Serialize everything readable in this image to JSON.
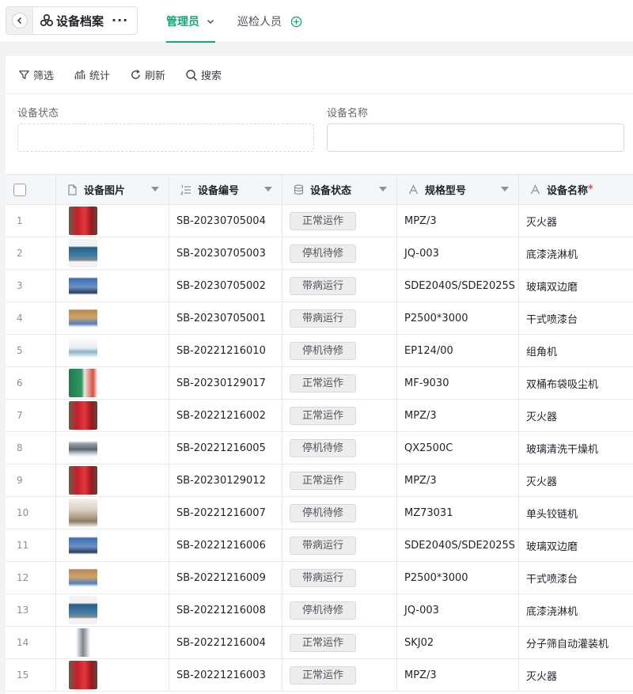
{
  "header": {
    "app_title": "设备档案",
    "tabs": [
      {
        "label": "管理员",
        "active": true
      },
      {
        "label": "巡检人员",
        "active": false
      }
    ],
    "accent_color": "#15a675"
  },
  "toolbar": {
    "filter": "筛选",
    "stats": "统计",
    "refresh": "刷新",
    "search": "搜索"
  },
  "filters": {
    "status_label": "设备状态",
    "name_label": "设备名称"
  },
  "table": {
    "columns": [
      "设备图片",
      "设备编号",
      "设备状态",
      "规格型号",
      "设备名称"
    ],
    "required_mark": "*",
    "rows": [
      {
        "no": "1",
        "image": "fire-extinguisher",
        "code": "SB-20230705004",
        "status": "正常运作",
        "model": "MPZ/3",
        "name": "灭火器"
      },
      {
        "no": "2",
        "image": "paint-line",
        "code": "SB-20230705003",
        "status": "停机待修",
        "model": "JQ-003",
        "name": "底漆浇淋机"
      },
      {
        "no": "3",
        "image": "edge-grinder",
        "code": "SB-20230705002",
        "status": "带病运行",
        "model": "SDE2040S/SDE2025S",
        "name": "玻璃双边磨"
      },
      {
        "no": "4",
        "image": "spray-booth",
        "code": "SB-20230705001",
        "status": "带病运行",
        "model": "P2500*3000",
        "name": "干式喷漆台"
      },
      {
        "no": "5",
        "image": "corner-machine",
        "code": "SB-20221216010",
        "status": "停机待修",
        "model": "EP124/00",
        "name": "组角机"
      },
      {
        "no": "6",
        "image": "dust-collector",
        "code": "SB-20230129017",
        "status": "正常运作",
        "model": "MF-9030",
        "name": "双桶布袋吸尘机"
      },
      {
        "no": "7",
        "image": "fire-extinguisher",
        "code": "SB-20221216002",
        "status": "正常运作",
        "model": "MPZ/3",
        "name": "灭火器"
      },
      {
        "no": "8",
        "image": "glass-washer",
        "code": "SB-20221216005",
        "status": "停机待修",
        "model": "QX2500C",
        "name": "玻璃清洗干燥机"
      },
      {
        "no": "9",
        "image": "fire-extinguisher",
        "code": "SB-20230129012",
        "status": "正常运作",
        "model": "MPZ/3",
        "name": "灭火器"
      },
      {
        "no": "10",
        "image": "hinge-drill",
        "code": "SB-20221216007",
        "status": "停机待修",
        "model": "MZ73031",
        "name": "单头铰链机"
      },
      {
        "no": "11",
        "image": "edge-grinder",
        "code": "SB-20221216006",
        "status": "带病运行",
        "model": "SDE2040S/SDE2025S",
        "name": "玻璃双边磨"
      },
      {
        "no": "12",
        "image": "spray-booth",
        "code": "SB-20221216009",
        "status": "带病运行",
        "model": "P2500*3000",
        "name": "干式喷漆台"
      },
      {
        "no": "13",
        "image": "paint-line",
        "code": "SB-20221216008",
        "status": "停机待修",
        "model": "JQ-003",
        "name": "底漆浇淋机"
      },
      {
        "no": "14",
        "image": "filling-machine",
        "code": "SB-20221216004",
        "status": "正常运作",
        "model": "SKJ02",
        "name": "分子筛自动灌装机"
      },
      {
        "no": "15",
        "image": "fire-extinguisher",
        "code": "SB-20221216003",
        "status": "正常运作",
        "model": "MPZ/3",
        "name": "灭火器"
      }
    ]
  }
}
